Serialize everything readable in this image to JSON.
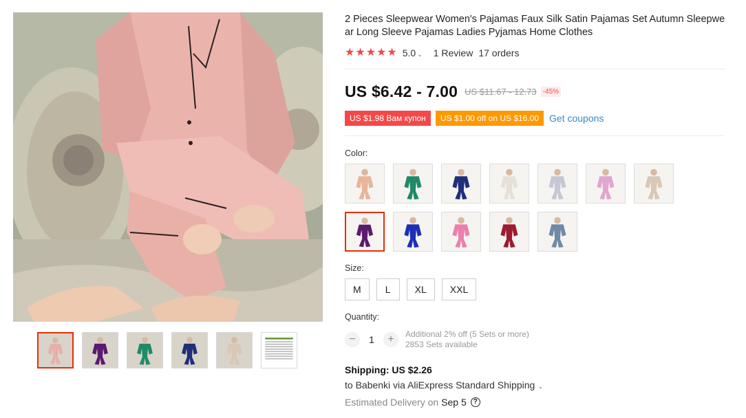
{
  "product": {
    "title": "2 Pieces Sleepwear Women's Pajamas Faux Silk Satin Pajamas Set Autumn Sleepwear Long Sleeve Pajamas Ladies Pyjamas Home Clothes",
    "rating": "5.0",
    "rating_icon": "star-icon",
    "rating_stars": 5,
    "reviews": "1 Review",
    "orders": "17 orders",
    "price": "US $6.42 - 7.00",
    "old_price": "US $11.67 - 12.73",
    "discount": "-45%"
  },
  "coupons": {
    "store_coupon": "US $1.98 Вам купон",
    "offer_coupon": "US $1.00 off on US $16.00",
    "get_coupons": "Get coupons"
  },
  "color": {
    "label": "Color:",
    "swatches": [
      {
        "name": "peach",
        "color": "#e8b49a"
      },
      {
        "name": "green",
        "color": "#1f8a68"
      },
      {
        "name": "navy",
        "color": "#1f2f7a"
      },
      {
        "name": "white",
        "color": "#e6e1d8"
      },
      {
        "name": "light-gray",
        "color": "#c5c8d2"
      },
      {
        "name": "pink-lilac",
        "color": "#e0a6cf"
      },
      {
        "name": "champagne",
        "color": "#d9c8b6"
      },
      {
        "name": "purple",
        "color": "#5a1a6e"
      },
      {
        "name": "royal-blue",
        "color": "#1d2fb6"
      },
      {
        "name": "rose-pink",
        "color": "#ea7fae"
      },
      {
        "name": "wine-red",
        "color": "#9e1a2f"
      },
      {
        "name": "steel-blue",
        "color": "#6f8aa8"
      }
    ],
    "selected_index": 7
  },
  "size": {
    "label": "Size:",
    "options": [
      "M",
      "L",
      "XL",
      "XXL"
    ]
  },
  "quantity": {
    "label": "Quantity:",
    "value": "1",
    "minus": "−",
    "plus": "+",
    "note_line1": "Additional 2% off (5 Sets or more)",
    "note_line2": "2853 Sets available"
  },
  "shipping": {
    "cost": "Shipping: US $2.26",
    "to": "to Babenki via AliExpress Standard Shipping",
    "estimated_label": "Estimated Delivery on",
    "estimated_date": "Sep 5",
    "help_icon": "question-icon"
  },
  "gallery": {
    "thumb_colors": [
      "#e8b0aa",
      "#5a1a6e",
      "#1f8a68",
      "#1f2f7a",
      "#d9c8b6",
      "#ffffff"
    ],
    "active_index": 0
  },
  "colors": {
    "price_red": "#f44848",
    "coupon_orange": "#ff9900",
    "link_blue": "#3a86c8",
    "selected_border": "#e62e04"
  }
}
